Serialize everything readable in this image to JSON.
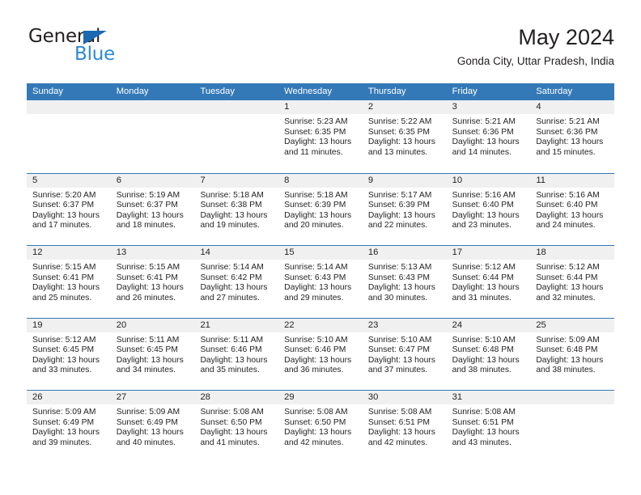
{
  "brand": {
    "name_part1": "General",
    "name_part2": "Blue",
    "triangle_color": "#1b69b2",
    "blue_text_color": "#2b8ad6"
  },
  "header": {
    "title": "May 2024",
    "subtitle": "Gonda City, Uttar Pradesh, India"
  },
  "colors": {
    "header_blue": "#3479b7",
    "daynum_band": "#f0f0f0",
    "text": "#231f20"
  },
  "weekdays": [
    "Sunday",
    "Monday",
    "Tuesday",
    "Wednesday",
    "Thursday",
    "Friday",
    "Saturday"
  ],
  "weeks": [
    [
      {
        "day": "",
        "sunrise": "",
        "sunset": "",
        "daylight_line1": "",
        "daylight_line2": ""
      },
      {
        "day": "",
        "sunrise": "",
        "sunset": "",
        "daylight_line1": "",
        "daylight_line2": ""
      },
      {
        "day": "",
        "sunrise": "",
        "sunset": "",
        "daylight_line1": "",
        "daylight_line2": ""
      },
      {
        "day": "1",
        "sunrise": "Sunrise: 5:23 AM",
        "sunset": "Sunset: 6:35 PM",
        "daylight_line1": "Daylight: 13 hours",
        "daylight_line2": "and 11 minutes."
      },
      {
        "day": "2",
        "sunrise": "Sunrise: 5:22 AM",
        "sunset": "Sunset: 6:35 PM",
        "daylight_line1": "Daylight: 13 hours",
        "daylight_line2": "and 13 minutes."
      },
      {
        "day": "3",
        "sunrise": "Sunrise: 5:21 AM",
        "sunset": "Sunset: 6:36 PM",
        "daylight_line1": "Daylight: 13 hours",
        "daylight_line2": "and 14 minutes."
      },
      {
        "day": "4",
        "sunrise": "Sunrise: 5:21 AM",
        "sunset": "Sunset: 6:36 PM",
        "daylight_line1": "Daylight: 13 hours",
        "daylight_line2": "and 15 minutes."
      }
    ],
    [
      {
        "day": "5",
        "sunrise": "Sunrise: 5:20 AM",
        "sunset": "Sunset: 6:37 PM",
        "daylight_line1": "Daylight: 13 hours",
        "daylight_line2": "and 17 minutes."
      },
      {
        "day": "6",
        "sunrise": "Sunrise: 5:19 AM",
        "sunset": "Sunset: 6:37 PM",
        "daylight_line1": "Daylight: 13 hours",
        "daylight_line2": "and 18 minutes."
      },
      {
        "day": "7",
        "sunrise": "Sunrise: 5:18 AM",
        "sunset": "Sunset: 6:38 PM",
        "daylight_line1": "Daylight: 13 hours",
        "daylight_line2": "and 19 minutes."
      },
      {
        "day": "8",
        "sunrise": "Sunrise: 5:18 AM",
        "sunset": "Sunset: 6:39 PM",
        "daylight_line1": "Daylight: 13 hours",
        "daylight_line2": "and 20 minutes."
      },
      {
        "day": "9",
        "sunrise": "Sunrise: 5:17 AM",
        "sunset": "Sunset: 6:39 PM",
        "daylight_line1": "Daylight: 13 hours",
        "daylight_line2": "and 22 minutes."
      },
      {
        "day": "10",
        "sunrise": "Sunrise: 5:16 AM",
        "sunset": "Sunset: 6:40 PM",
        "daylight_line1": "Daylight: 13 hours",
        "daylight_line2": "and 23 minutes."
      },
      {
        "day": "11",
        "sunrise": "Sunrise: 5:16 AM",
        "sunset": "Sunset: 6:40 PM",
        "daylight_line1": "Daylight: 13 hours",
        "daylight_line2": "and 24 minutes."
      }
    ],
    [
      {
        "day": "12",
        "sunrise": "Sunrise: 5:15 AM",
        "sunset": "Sunset: 6:41 PM",
        "daylight_line1": "Daylight: 13 hours",
        "daylight_line2": "and 25 minutes."
      },
      {
        "day": "13",
        "sunrise": "Sunrise: 5:15 AM",
        "sunset": "Sunset: 6:41 PM",
        "daylight_line1": "Daylight: 13 hours",
        "daylight_line2": "and 26 minutes."
      },
      {
        "day": "14",
        "sunrise": "Sunrise: 5:14 AM",
        "sunset": "Sunset: 6:42 PM",
        "daylight_line1": "Daylight: 13 hours",
        "daylight_line2": "and 27 minutes."
      },
      {
        "day": "15",
        "sunrise": "Sunrise: 5:14 AM",
        "sunset": "Sunset: 6:43 PM",
        "daylight_line1": "Daylight: 13 hours",
        "daylight_line2": "and 29 minutes."
      },
      {
        "day": "16",
        "sunrise": "Sunrise: 5:13 AM",
        "sunset": "Sunset: 6:43 PM",
        "daylight_line1": "Daylight: 13 hours",
        "daylight_line2": "and 30 minutes."
      },
      {
        "day": "17",
        "sunrise": "Sunrise: 5:12 AM",
        "sunset": "Sunset: 6:44 PM",
        "daylight_line1": "Daylight: 13 hours",
        "daylight_line2": "and 31 minutes."
      },
      {
        "day": "18",
        "sunrise": "Sunrise: 5:12 AM",
        "sunset": "Sunset: 6:44 PM",
        "daylight_line1": "Daylight: 13 hours",
        "daylight_line2": "and 32 minutes."
      }
    ],
    [
      {
        "day": "19",
        "sunrise": "Sunrise: 5:12 AM",
        "sunset": "Sunset: 6:45 PM",
        "daylight_line1": "Daylight: 13 hours",
        "daylight_line2": "and 33 minutes."
      },
      {
        "day": "20",
        "sunrise": "Sunrise: 5:11 AM",
        "sunset": "Sunset: 6:45 PM",
        "daylight_line1": "Daylight: 13 hours",
        "daylight_line2": "and 34 minutes."
      },
      {
        "day": "21",
        "sunrise": "Sunrise: 5:11 AM",
        "sunset": "Sunset: 6:46 PM",
        "daylight_line1": "Daylight: 13 hours",
        "daylight_line2": "and 35 minutes."
      },
      {
        "day": "22",
        "sunrise": "Sunrise: 5:10 AM",
        "sunset": "Sunset: 6:46 PM",
        "daylight_line1": "Daylight: 13 hours",
        "daylight_line2": "and 36 minutes."
      },
      {
        "day": "23",
        "sunrise": "Sunrise: 5:10 AM",
        "sunset": "Sunset: 6:47 PM",
        "daylight_line1": "Daylight: 13 hours",
        "daylight_line2": "and 37 minutes."
      },
      {
        "day": "24",
        "sunrise": "Sunrise: 5:10 AM",
        "sunset": "Sunset: 6:48 PM",
        "daylight_line1": "Daylight: 13 hours",
        "daylight_line2": "and 38 minutes."
      },
      {
        "day": "25",
        "sunrise": "Sunrise: 5:09 AM",
        "sunset": "Sunset: 6:48 PM",
        "daylight_line1": "Daylight: 13 hours",
        "daylight_line2": "and 38 minutes."
      }
    ],
    [
      {
        "day": "26",
        "sunrise": "Sunrise: 5:09 AM",
        "sunset": "Sunset: 6:49 PM",
        "daylight_line1": "Daylight: 13 hours",
        "daylight_line2": "and 39 minutes."
      },
      {
        "day": "27",
        "sunrise": "Sunrise: 5:09 AM",
        "sunset": "Sunset: 6:49 PM",
        "daylight_line1": "Daylight: 13 hours",
        "daylight_line2": "and 40 minutes."
      },
      {
        "day": "28",
        "sunrise": "Sunrise: 5:08 AM",
        "sunset": "Sunset: 6:50 PM",
        "daylight_line1": "Daylight: 13 hours",
        "daylight_line2": "and 41 minutes."
      },
      {
        "day": "29",
        "sunrise": "Sunrise: 5:08 AM",
        "sunset": "Sunset: 6:50 PM",
        "daylight_line1": "Daylight: 13 hours",
        "daylight_line2": "and 42 minutes."
      },
      {
        "day": "30",
        "sunrise": "Sunrise: 5:08 AM",
        "sunset": "Sunset: 6:51 PM",
        "daylight_line1": "Daylight: 13 hours",
        "daylight_line2": "and 42 minutes."
      },
      {
        "day": "31",
        "sunrise": "Sunrise: 5:08 AM",
        "sunset": "Sunset: 6:51 PM",
        "daylight_line1": "Daylight: 13 hours",
        "daylight_line2": "and 43 minutes."
      },
      {
        "day": "",
        "sunrise": "",
        "sunset": "",
        "daylight_line1": "",
        "daylight_line2": ""
      }
    ]
  ]
}
